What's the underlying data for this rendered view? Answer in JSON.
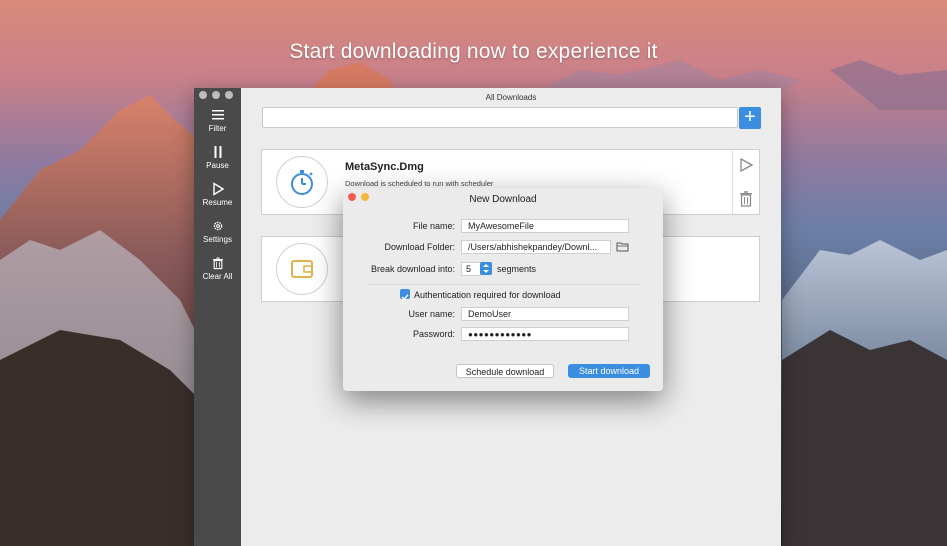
{
  "headline": "Start downloading now to experience it",
  "window": {
    "title": "All Downloads",
    "search": {
      "value": "",
      "placeholder": ""
    },
    "add_label": "+"
  },
  "sidebar": {
    "items": [
      {
        "label": "Filter",
        "icon": "filter-icon"
      },
      {
        "label": "Pause",
        "icon": "pause-icon"
      },
      {
        "label": "Resume",
        "icon": "play-icon"
      },
      {
        "label": "Settings",
        "icon": "gear-icon"
      },
      {
        "label": "Clear All",
        "icon": "trash-icon"
      }
    ]
  },
  "downloads": [
    {
      "name": "MetaSync.Dmg",
      "status": "Download is scheduled to run with scheduler",
      "icon": "stopwatch-icon"
    },
    {
      "name": "",
      "status": "",
      "icon": "wallet-icon"
    }
  ],
  "dialog": {
    "title": "New Download",
    "file_name_label": "File name:",
    "file_name_value": "MyAwesomeFile",
    "folder_label": "Download Folder:",
    "folder_value": "/Users/abhishekpandey/Downl...",
    "break_label": "Break download into:",
    "segments_value": "5",
    "segments_unit": "segments",
    "auth_label": "Authentication required for download",
    "auth_checked": true,
    "username_label": "User name:",
    "username_value": "DemoUser",
    "password_label": "Password:",
    "password_value": "●●●●●●●●●●●●",
    "schedule_button": "Schedule download",
    "start_button": "Start download"
  },
  "colors": {
    "accent": "#3b8de0",
    "sidebar": "#4a4a4a",
    "icon_accent": "#3b8de0",
    "wallet": "#e0b24a",
    "close": "#f25c54",
    "minimize": "#f5b83a"
  }
}
